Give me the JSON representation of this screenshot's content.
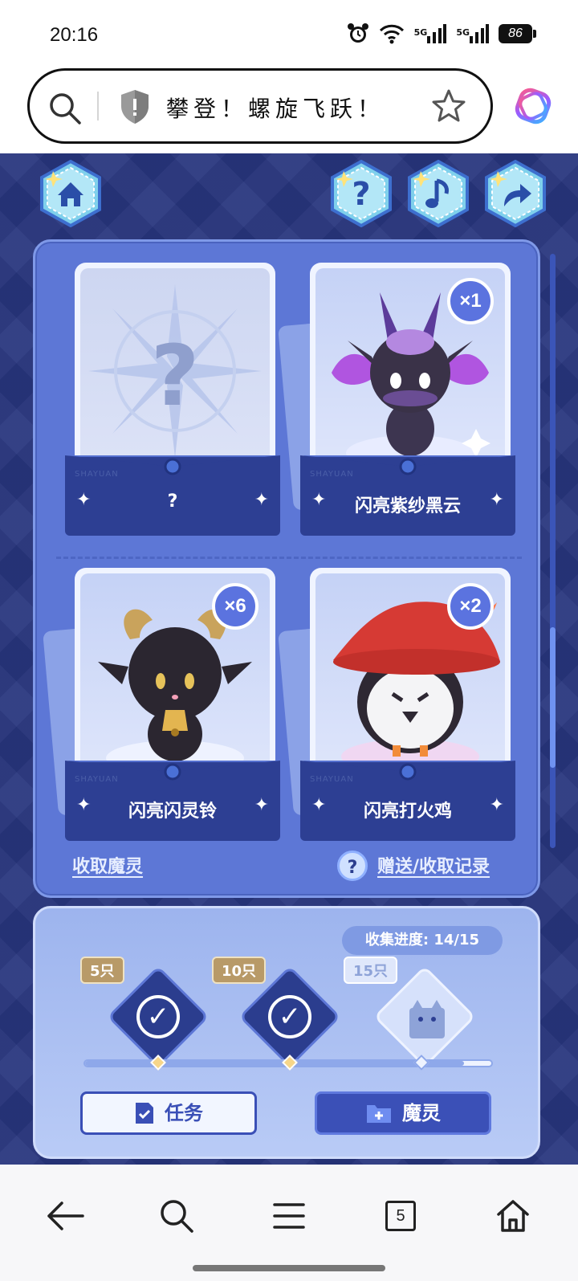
{
  "status_bar": {
    "time": "20:16",
    "network_1": "5G",
    "network_2": "5G",
    "battery": "86"
  },
  "browser": {
    "page_title": "攀登！螺旋飞跃！"
  },
  "game": {
    "top_buttons": [
      "home-icon",
      "question-icon",
      "music-note-icon",
      "share-icon"
    ],
    "cards": [
      {
        "name": "?",
        "count": "",
        "unknown_mark": "?"
      },
      {
        "name": "闪亮紫纱黑云",
        "count": "×1"
      },
      {
        "name": "闪亮闪灵铃",
        "count": "×6"
      },
      {
        "name": "闪亮打火鸡",
        "count": "×2"
      }
    ],
    "card_stamp": "SHAYUAN",
    "links": {
      "collect": "收取魔灵",
      "help": "?",
      "records": "赠送/收取记录"
    },
    "progress": {
      "label": "收集进度: 14/15",
      "collected": 14,
      "total": 15,
      "milestones": [
        {
          "tag": "5只",
          "done": true
        },
        {
          "tag": "10只",
          "done": true
        },
        {
          "tag": "15只",
          "done": false
        }
      ]
    },
    "tabs": {
      "task": "任务",
      "spirit": "魔灵"
    }
  },
  "navbar": {
    "tab_count": "5"
  },
  "colors": {
    "game_bg": "#27357d",
    "panel": "#5d77d6",
    "accent": "#3b50b7"
  }
}
